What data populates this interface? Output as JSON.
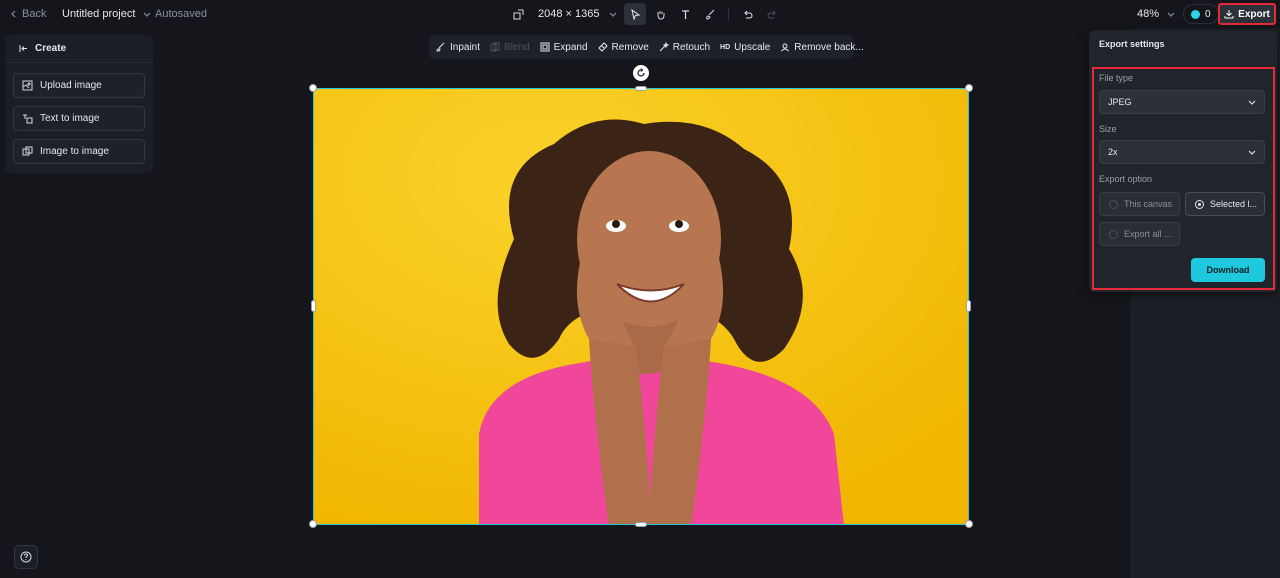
{
  "header": {
    "back_label": "Back",
    "project_title": "Untitled project",
    "autosave_status": "Autosaved",
    "canvas_dimensions": "2048 × 1365",
    "zoom_level": "48%",
    "credits": "0",
    "export_label": "Export"
  },
  "left_panel": {
    "title": "Create",
    "items": [
      {
        "label": "Upload image",
        "icon": "upload-image-icon"
      },
      {
        "label": "Text to image",
        "icon": "text-to-image-icon"
      },
      {
        "label": "Image to image",
        "icon": "image-to-image-icon"
      }
    ]
  },
  "edit_toolbar": {
    "items": [
      {
        "label": "Inpaint",
        "enabled": true
      },
      {
        "label": "Blend",
        "enabled": false
      },
      {
        "label": "Expand",
        "enabled": true
      },
      {
        "label": "Remove",
        "enabled": true
      },
      {
        "label": "Retouch",
        "enabled": true
      },
      {
        "label": "Upscale",
        "enabled": true,
        "badge": "HD"
      },
      {
        "label": "Remove back...",
        "enabled": true
      }
    ]
  },
  "export_settings": {
    "title": "Export settings",
    "file_type_label": "File type",
    "file_type_value": "JPEG",
    "size_label": "Size",
    "size_value": "2x",
    "export_option_label": "Export option",
    "options": [
      {
        "label": "This canvas",
        "selected": false
      },
      {
        "label": "Selected l...",
        "selected": true
      },
      {
        "label": "Export all ...",
        "selected": false
      }
    ],
    "download_label": "Download"
  },
  "colors": {
    "accent": "#1ec9dd",
    "highlight": "#e52b3a",
    "canvas_background": "#f6c200",
    "shirt": "#f0479a"
  }
}
